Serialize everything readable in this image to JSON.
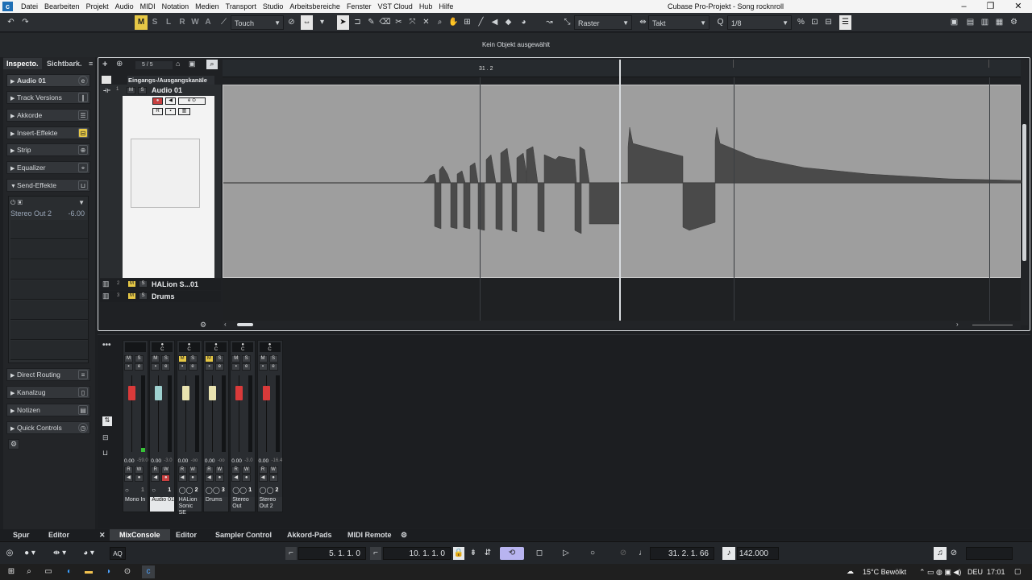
{
  "window": {
    "title": "Cubase Pro-Projekt - Song rocknroll"
  },
  "menu": [
    "Datei",
    "Bearbeiten",
    "Projekt",
    "Audio",
    "MIDI",
    "Notation",
    "Medien",
    "Transport",
    "Studio",
    "Arbeitsbereiche",
    "Fenster",
    "VST Cloud",
    "Hub",
    "Hilfe"
  ],
  "toolbar": {
    "automation_modes": [
      "M",
      "S",
      "L",
      "R",
      "W",
      "A"
    ],
    "automation_value": "Touch",
    "snap_type": "Raster",
    "grid_type": "Takt",
    "quantize": "1/8"
  },
  "infoline": {
    "text": "Kein Objekt ausgewählt"
  },
  "inspector": {
    "tabs": [
      "Inspecto.",
      "Sichtbark."
    ],
    "track_name": "Audio 01",
    "sections": [
      "Track Versions",
      "Akkorde",
      "Insert-Effekte",
      "Strip",
      "Equalizer",
      "Send-Effekte"
    ],
    "send": {
      "name": "Stereo Out 2",
      "value": "-6.00"
    },
    "lower_sections": [
      "Direct Routing",
      "Kanalzug",
      "Notizen",
      "Quick Controls"
    ]
  },
  "project": {
    "track_count": "5 / 5",
    "folder": "Eingangs-/Ausgangskanäle",
    "ruler_marker": "31 . 2",
    "tracks": [
      {
        "num": "1",
        "name": "Audio 01"
      },
      {
        "num": "2",
        "name": "HALion S...01"
      },
      {
        "num": "3",
        "name": "Drums"
      }
    ]
  },
  "mixer": {
    "channels": [
      {
        "name": "Mono In",
        "value": "0.00",
        "peak": "-59.0",
        "num": "1",
        "color": "#d93a3a",
        "meter": 0.05
      },
      {
        "name": "Audio 01",
        "value": "0.00",
        "peak": "-3.0",
        "num": "1",
        "color": "#9ed1d0",
        "meter": 0.0
      },
      {
        "name": "HALion Sonic SE",
        "value": "0.00",
        "peak": "-oo",
        "num": "2",
        "color": "#e9e3b0",
        "meter": 0.0
      },
      {
        "name": "Drums",
        "value": "0.00",
        "peak": "-oo",
        "num": "3",
        "color": "#e9e3b0",
        "meter": 0.0
      },
      {
        "name": "Stereo Out",
        "value": "0.00",
        "peak": "-3.0",
        "num": "1",
        "color": "#d93a3a",
        "meter": 0.0
      },
      {
        "name": "Stereo Out 2",
        "value": "0.00",
        "peak": "-16.4",
        "num": "2",
        "color": "#d93a3a",
        "meter": 0.0
      }
    ]
  },
  "bottom_tabs": {
    "left": [
      "Spur",
      "Editor"
    ],
    "lower": [
      "MixConsole",
      "Editor",
      "Sampler Control",
      "Akkord-Pads",
      "MIDI Remote"
    ]
  },
  "transport": {
    "left_locator": "5. 1. 1.  0",
    "right_locator": "10. 1. 1.  0",
    "position": "31. 2. 1. 66",
    "tempo": "142.000",
    "aq": "AQ"
  },
  "taskbar": {
    "weather": "15°C  Bewölkt",
    "lang": "DEU",
    "time": "17:01"
  }
}
